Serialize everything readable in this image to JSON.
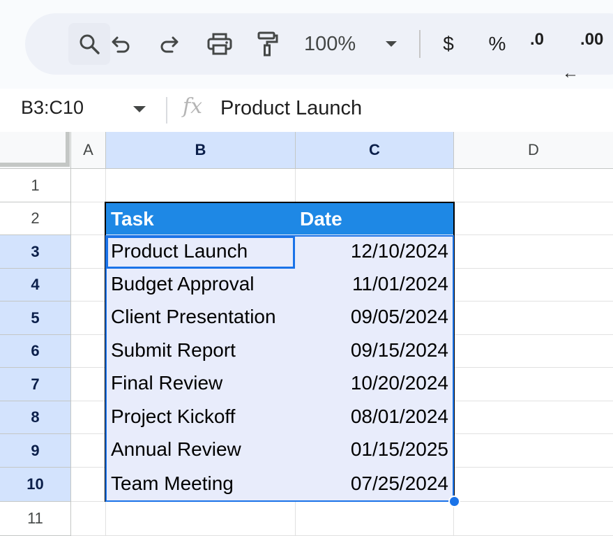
{
  "toolbar": {
    "zoom": "100%",
    "currency": "$",
    "percent": "%",
    "decrease_decimal": ".0",
    "increase_decimal": ".00",
    "icons": [
      "search-icon",
      "undo-icon",
      "redo-icon",
      "print-icon",
      "paint-format-icon",
      "chevron-down-icon",
      "arrow-left-icon",
      "arrow-right-icon"
    ]
  },
  "formula_bar": {
    "name_box": "B3:C10",
    "fx": "fx",
    "value": "Product Launch"
  },
  "grid": {
    "columns": [
      "A",
      "B",
      "C",
      "D"
    ],
    "rows": [
      "1",
      "2",
      "3",
      "4",
      "5",
      "6",
      "7",
      "8",
      "9",
      "10",
      "11"
    ],
    "selected_columns": [
      "B",
      "C"
    ],
    "selected_rows": [
      "3",
      "4",
      "5",
      "6",
      "7",
      "8",
      "9",
      "10"
    ],
    "table": {
      "headers": [
        "Task",
        "Date"
      ],
      "rows": [
        [
          "Product Launch",
          "12/10/2024"
        ],
        [
          "Budget Approval",
          "11/01/2024"
        ],
        [
          "Client Presentation",
          "09/05/2024"
        ],
        [
          "Submit Report",
          "09/15/2024"
        ],
        [
          "Final Review",
          "10/20/2024"
        ],
        [
          "Project Kickoff",
          "08/01/2024"
        ],
        [
          "Annual Review",
          "01/15/2025"
        ],
        [
          "Team Meeting",
          "07/25/2024"
        ]
      ]
    },
    "colors": {
      "header_fill": "#1e88e5",
      "cell_fill": "#e8ecfb",
      "selection": "#1a73e8",
      "selected_header": "#d3e3fd"
    }
  }
}
